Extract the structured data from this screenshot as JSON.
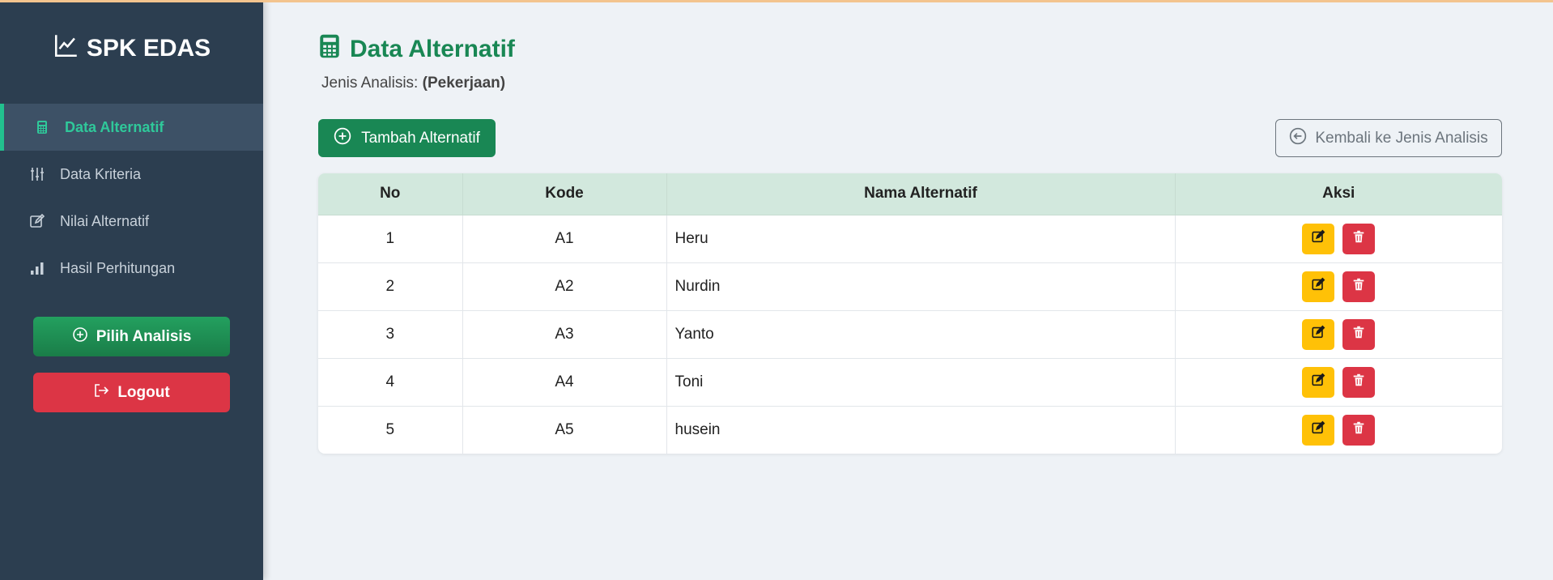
{
  "sidebar": {
    "brand": "SPK EDAS",
    "items": [
      {
        "label": "Data Alternatif",
        "icon": "calculator-icon",
        "active": true
      },
      {
        "label": "Data Kriteria",
        "icon": "sliders-icon",
        "active": false
      },
      {
        "label": "Nilai Alternatif",
        "icon": "edit-icon",
        "active": false
      },
      {
        "label": "Hasil Perhitungan",
        "icon": "bar-chart-icon",
        "active": false
      }
    ],
    "pilih_label": "Pilih Analisis",
    "logout_label": "Logout"
  },
  "main": {
    "title": "Data Alternatif",
    "subtitle_label": "Jenis Analisis:",
    "subtitle_value": "(Pekerjaan)",
    "add_label": "Tambah Alternatif",
    "back_label": "Kembali ke Jenis Analisis"
  },
  "table": {
    "headers": [
      "No",
      "Kode",
      "Nama Alternatif",
      "Aksi"
    ],
    "rows": [
      {
        "no": "1",
        "kode": "A1",
        "nama": "Heru"
      },
      {
        "no": "2",
        "kode": "A2",
        "nama": "Nurdin"
      },
      {
        "no": "3",
        "kode": "A3",
        "nama": "Yanto"
      },
      {
        "no": "4",
        "kode": "A4",
        "nama": "Toni"
      },
      {
        "no": "5",
        "kode": "A5",
        "nama": "husein"
      }
    ]
  },
  "colors": {
    "sidebar_bg": "#2c3e50",
    "accent_green": "#198754",
    "active_text": "#2fc89a",
    "edit_button": "#ffc107",
    "delete_button": "#dc3545",
    "table_header": "#d2e8dd"
  }
}
